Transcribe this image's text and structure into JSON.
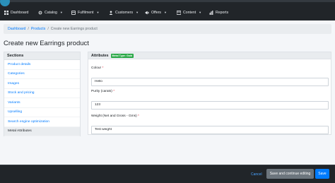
{
  "nav": {
    "items": [
      {
        "label": "Dashboard",
        "icon": "dashboard-icon",
        "has_dropdown": false
      },
      {
        "label": "Catalog",
        "icon": "catalog-icon",
        "has_dropdown": true
      },
      {
        "label": "Fulfilment",
        "icon": "fulfilment-icon",
        "has_dropdown": true
      },
      {
        "label": "Customers",
        "icon": "customers-icon",
        "has_dropdown": true
      },
      {
        "label": "Offers",
        "icon": "offers-icon",
        "has_dropdown": true
      },
      {
        "label": "Content",
        "icon": "content-icon",
        "has_dropdown": true
      },
      {
        "label": "Reports",
        "icon": "reports-icon",
        "has_dropdown": false
      }
    ]
  },
  "breadcrumb": [
    "Dashboard",
    "Products",
    "Create new Earrings product"
  ],
  "page_title": "Create new Earrings product",
  "sections": {
    "heading": "Sections",
    "items": [
      "Product details",
      "Categories",
      "Images",
      "Stock and pricing",
      "Variants",
      "Upselling",
      "Search engine optimization",
      "Metal Attributes"
    ],
    "active": "Metal Attributes"
  },
  "panel": {
    "title": "Attributes",
    "badge": "Metal Type: Gold",
    "fields": [
      {
        "label": "Colour",
        "required": "*",
        "value": "Hello"
      },
      {
        "label": "Purity (carats)",
        "required": "*",
        "value": "123"
      },
      {
        "label": "Weight (Net and Gross - Gms)",
        "required": "*",
        "value": "Test weight"
      }
    ]
  },
  "footer": {
    "cancel": "Cancel",
    "save_continue": "Save and continue editing",
    "save": "Save"
  },
  "colors": {
    "nav_bg": "#212529",
    "link": "#007bff",
    "badge": "#28a745",
    "primary": "#007bff",
    "secondary": "#6c757d"
  }
}
